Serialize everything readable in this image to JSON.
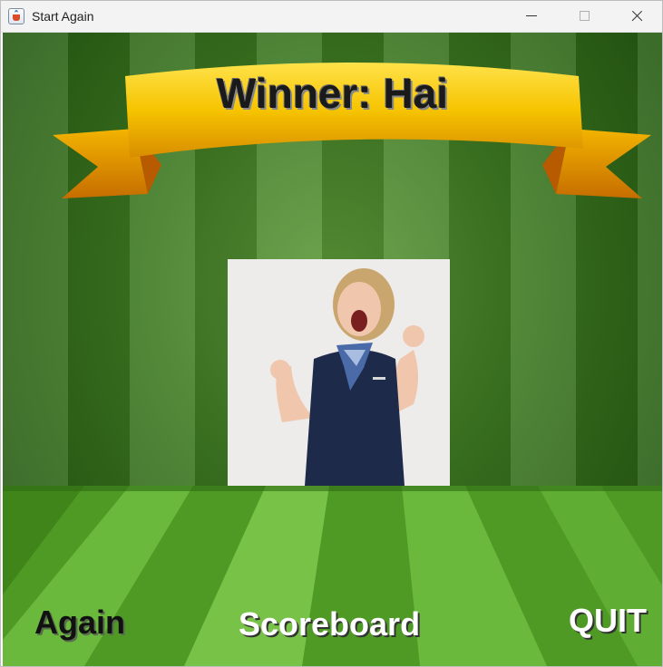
{
  "window": {
    "title": "Start Again"
  },
  "main": {
    "winner_text": "Winner: Hai"
  },
  "buttons": {
    "again": "Again",
    "scoreboard": "Scoreboard",
    "quit": "QUIT"
  },
  "colors": {
    "background_green": "#3e7a22",
    "floor_green": "#58a12c",
    "ribbon_gold": "#f2c200"
  }
}
